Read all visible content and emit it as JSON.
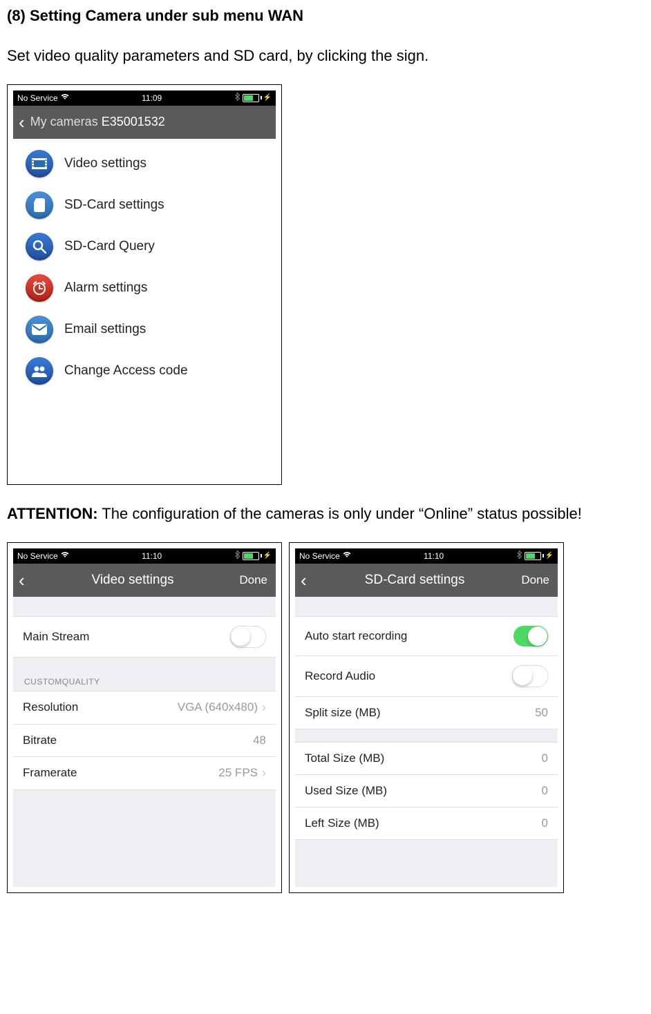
{
  "doc": {
    "heading": "(8) Setting Camera under sub menu WAN",
    "intro": "Set video quality parameters and SD card, by clicking the sign.",
    "attention_label": "ATTENTION:",
    "attention_text": " The configuration of the cameras is only under “Online” status possible!"
  },
  "screen1": {
    "status": {
      "carrier": "No Service",
      "time": "11:09"
    },
    "nav": {
      "back": "My cameras",
      "id": "E35001532"
    },
    "items": [
      {
        "label": "Video settings",
        "icon": "film-icon",
        "color": "ic-blue"
      },
      {
        "label": "SD-Card settings",
        "icon": "sdcard-icon",
        "color": "ic-blue2"
      },
      {
        "label": "SD-Card Query",
        "icon": "search-icon",
        "color": "ic-blue"
      },
      {
        "label": "Alarm settings",
        "icon": "alarm-icon",
        "color": "ic-red"
      },
      {
        "label": "Email settings",
        "icon": "mail-icon",
        "color": "ic-blue2"
      },
      {
        "label": "Change Access code",
        "icon": "users-icon",
        "color": "ic-blue"
      }
    ]
  },
  "screen2": {
    "status": {
      "carrier": "No Service",
      "time": "11:10"
    },
    "nav": {
      "title": "Video settings",
      "done": "Done"
    },
    "main_stream_label": "Main Stream",
    "main_stream_on": false,
    "section_header": "CUSTOMQUALITY",
    "rows": {
      "resolution_label": "Resolution",
      "resolution_value": "VGA (640x480)",
      "bitrate_label": "Bitrate",
      "bitrate_value": "48",
      "framerate_label": "Framerate",
      "framerate_value": "25 FPS"
    }
  },
  "screen3": {
    "status": {
      "carrier": "No Service",
      "time": "11:10"
    },
    "nav": {
      "title": "SD-Card settings",
      "done": "Done"
    },
    "rows": {
      "auto_start_label": "Auto start recording",
      "auto_start_on": true,
      "record_audio_label": "Record Audio",
      "record_audio_on": false,
      "split_label": "Split size (MB)",
      "split_value": "50",
      "total_label": "Total Size (MB)",
      "total_value": "0",
      "used_label": "Used Size (MB)",
      "used_value": "0",
      "left_label": "Left Size (MB)",
      "left_value": "0"
    }
  }
}
